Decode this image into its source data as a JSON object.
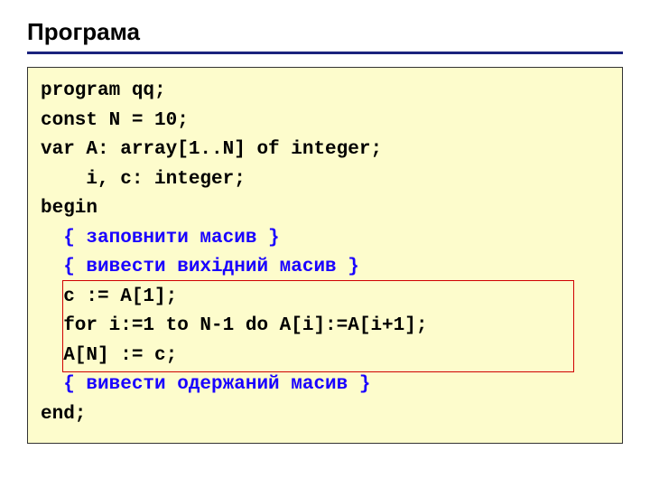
{
  "title": "Програма",
  "code": {
    "l1": "program qq;",
    "l2": "const N = 10;",
    "l3": "var A: array[1..N] of integer;",
    "l4": "    i, c: integer;",
    "l5": "begin",
    "l6": "  { заповнити масив }",
    "l7": "  { вивести вихідний масив }",
    "l8": "  c := A[1];",
    "l9": "  for i:=1 to N-1 do A[i]:=A[i+1];",
    "l10": "  A[N] := c;",
    "l11": "  { вивести одержаний масив }",
    "l12": "end;"
  }
}
